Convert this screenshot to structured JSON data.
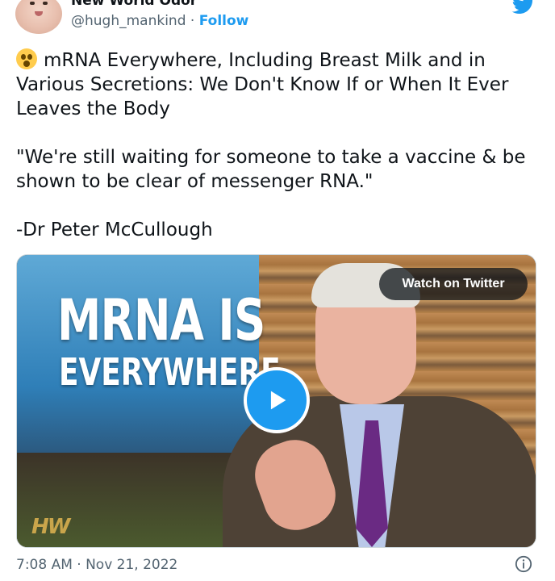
{
  "author": {
    "name": "New World Odor™",
    "handle": "@hugh_mankind",
    "separator": "·",
    "follow_label": "Follow",
    "avatar_icon": "avatar-photo-baby"
  },
  "brand_icon": "twitter-bird-icon",
  "tweet": {
    "emoji": "astonished-face",
    "headline": "mRNA Everywhere, Including Breast Milk and in Various Secretions: We Don't Know If or When It Ever Leaves the Body",
    "quote": "\"We're still waiting for someone to take a vaccine & be shown to be clear of messenger RNA.\"",
    "attribution": "-Dr Peter McCullough"
  },
  "media": {
    "headline_line1": "MRNA IS",
    "headline_line2": "EVERYWHERE",
    "logo_text": "HW",
    "watch_label": "Watch on Twitter",
    "play_icon": "play-icon"
  },
  "footer": {
    "timestamp": "7:08 AM · Nov 21, 2022",
    "info_icon": "info-icon"
  },
  "colors": {
    "accent": "#1d9bf0",
    "text": "#0f1419",
    "muted": "#536471"
  }
}
